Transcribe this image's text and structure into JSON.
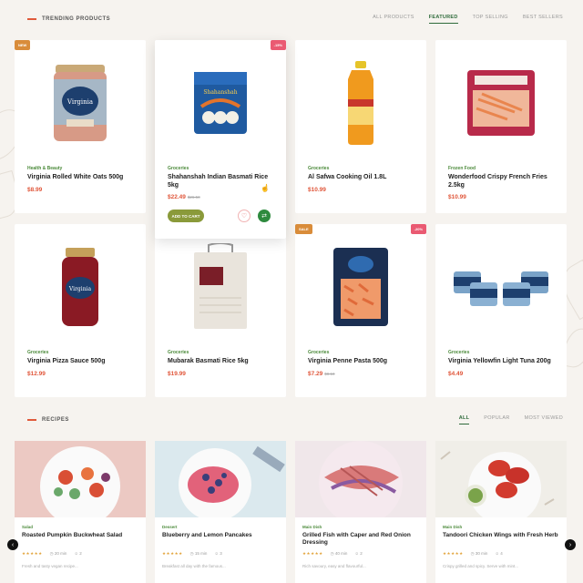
{
  "products_section": {
    "title": "TRENDING PRODUCTS",
    "tabs": [
      "ALL PRODUCTS",
      "FEATURED",
      "TOP SELLING",
      "BEST SELLERS"
    ],
    "active_tab": "FEATURED"
  },
  "products": [
    {
      "badge": "NEW",
      "badge_side": "left",
      "category": "Health & Beauty",
      "name": "Virginia Rolled White Oats 500g",
      "price": "$8.99",
      "old_price": ""
    },
    {
      "badge": "-15%",
      "badge_side": "right",
      "category": "Groceries",
      "name": "Shahanshah Indian Basmati Rice 5kg",
      "price": "$22.49",
      "old_price": "$26.50",
      "hover": true,
      "add_label": "ADD TO CART"
    },
    {
      "badge": "",
      "badge_side": "",
      "category": "Groceries",
      "name": "Al Safwa Cooking Oil 1.8L",
      "price": "$10.99",
      "old_price": ""
    },
    {
      "badge": "",
      "badge_side": "",
      "category": "Frozen Food",
      "name": "Wonderfood Crispy French Fries 2.5kg",
      "price": "$10.99",
      "old_price": ""
    },
    {
      "badge": "",
      "badge_side": "",
      "category": "Groceries",
      "name": "Virginia Pizza Sauce 500g",
      "price": "$12.99",
      "old_price": ""
    },
    {
      "badge": "",
      "badge_side": "",
      "category": "Groceries",
      "name": "Mubarak Basmati Rice 5kg",
      "price": "$19.99",
      "old_price": ""
    },
    {
      "badge": "SALE",
      "badge_side": "left",
      "badge2": "-20%",
      "category": "Groceries",
      "name": "Virginia Penne Pasta 500g",
      "price": "$7.29",
      "old_price": "$8.10"
    },
    {
      "badge": "",
      "badge_side": "",
      "category": "Groceries",
      "name": "Virginia Yellowfin Light Tuna 200g",
      "price": "$4.49",
      "old_price": ""
    }
  ],
  "recipes_section": {
    "title": "RECIPES",
    "tabs": [
      "ALL",
      "POPULAR",
      "MOST VIEWED"
    ],
    "active_tab": "ALL"
  },
  "recipes": [
    {
      "category": "Salad",
      "name": "Roasted Pumpkin Buckwheat Salad",
      "time": "20 min",
      "servings": "2",
      "desc": "Fresh and tasty vegan recipe...",
      "stars": "★★★★★",
      "colors": [
        "#ecc9c3",
        "#d94f35",
        "#6aa86a"
      ]
    },
    {
      "category": "Dessert",
      "name": "Blueberry and Lemon Pancakes",
      "time": "15 min",
      "servings": "3",
      "desc": "Breakfast all day with the famous...",
      "stars": "★★★★★",
      "colors": [
        "#dbe9ee",
        "#e2627a",
        "#3b3f7a"
      ]
    },
    {
      "category": "Main Dish",
      "name": "Grilled Fish with Caper and Red Onion Dressing",
      "time": "40 min",
      "servings": "2",
      "desc": "Rich savoury, easy and flavourful...",
      "stars": "★★★★★",
      "colors": [
        "#f0e7ea",
        "#d97a7a",
        "#8a5aa0"
      ]
    },
    {
      "category": "Main Dish",
      "name": "Tandoori Chicken Wings with Fresh Herb",
      "time": "30 min",
      "servings": "4",
      "desc": "Crispy grilled and spicy. Serve with mint...",
      "stars": "★★★★★",
      "colors": [
        "#f0eee8",
        "#d23b2e",
        "#7aa34a"
      ]
    }
  ],
  "nav": {
    "prev": "‹",
    "next": "›"
  }
}
